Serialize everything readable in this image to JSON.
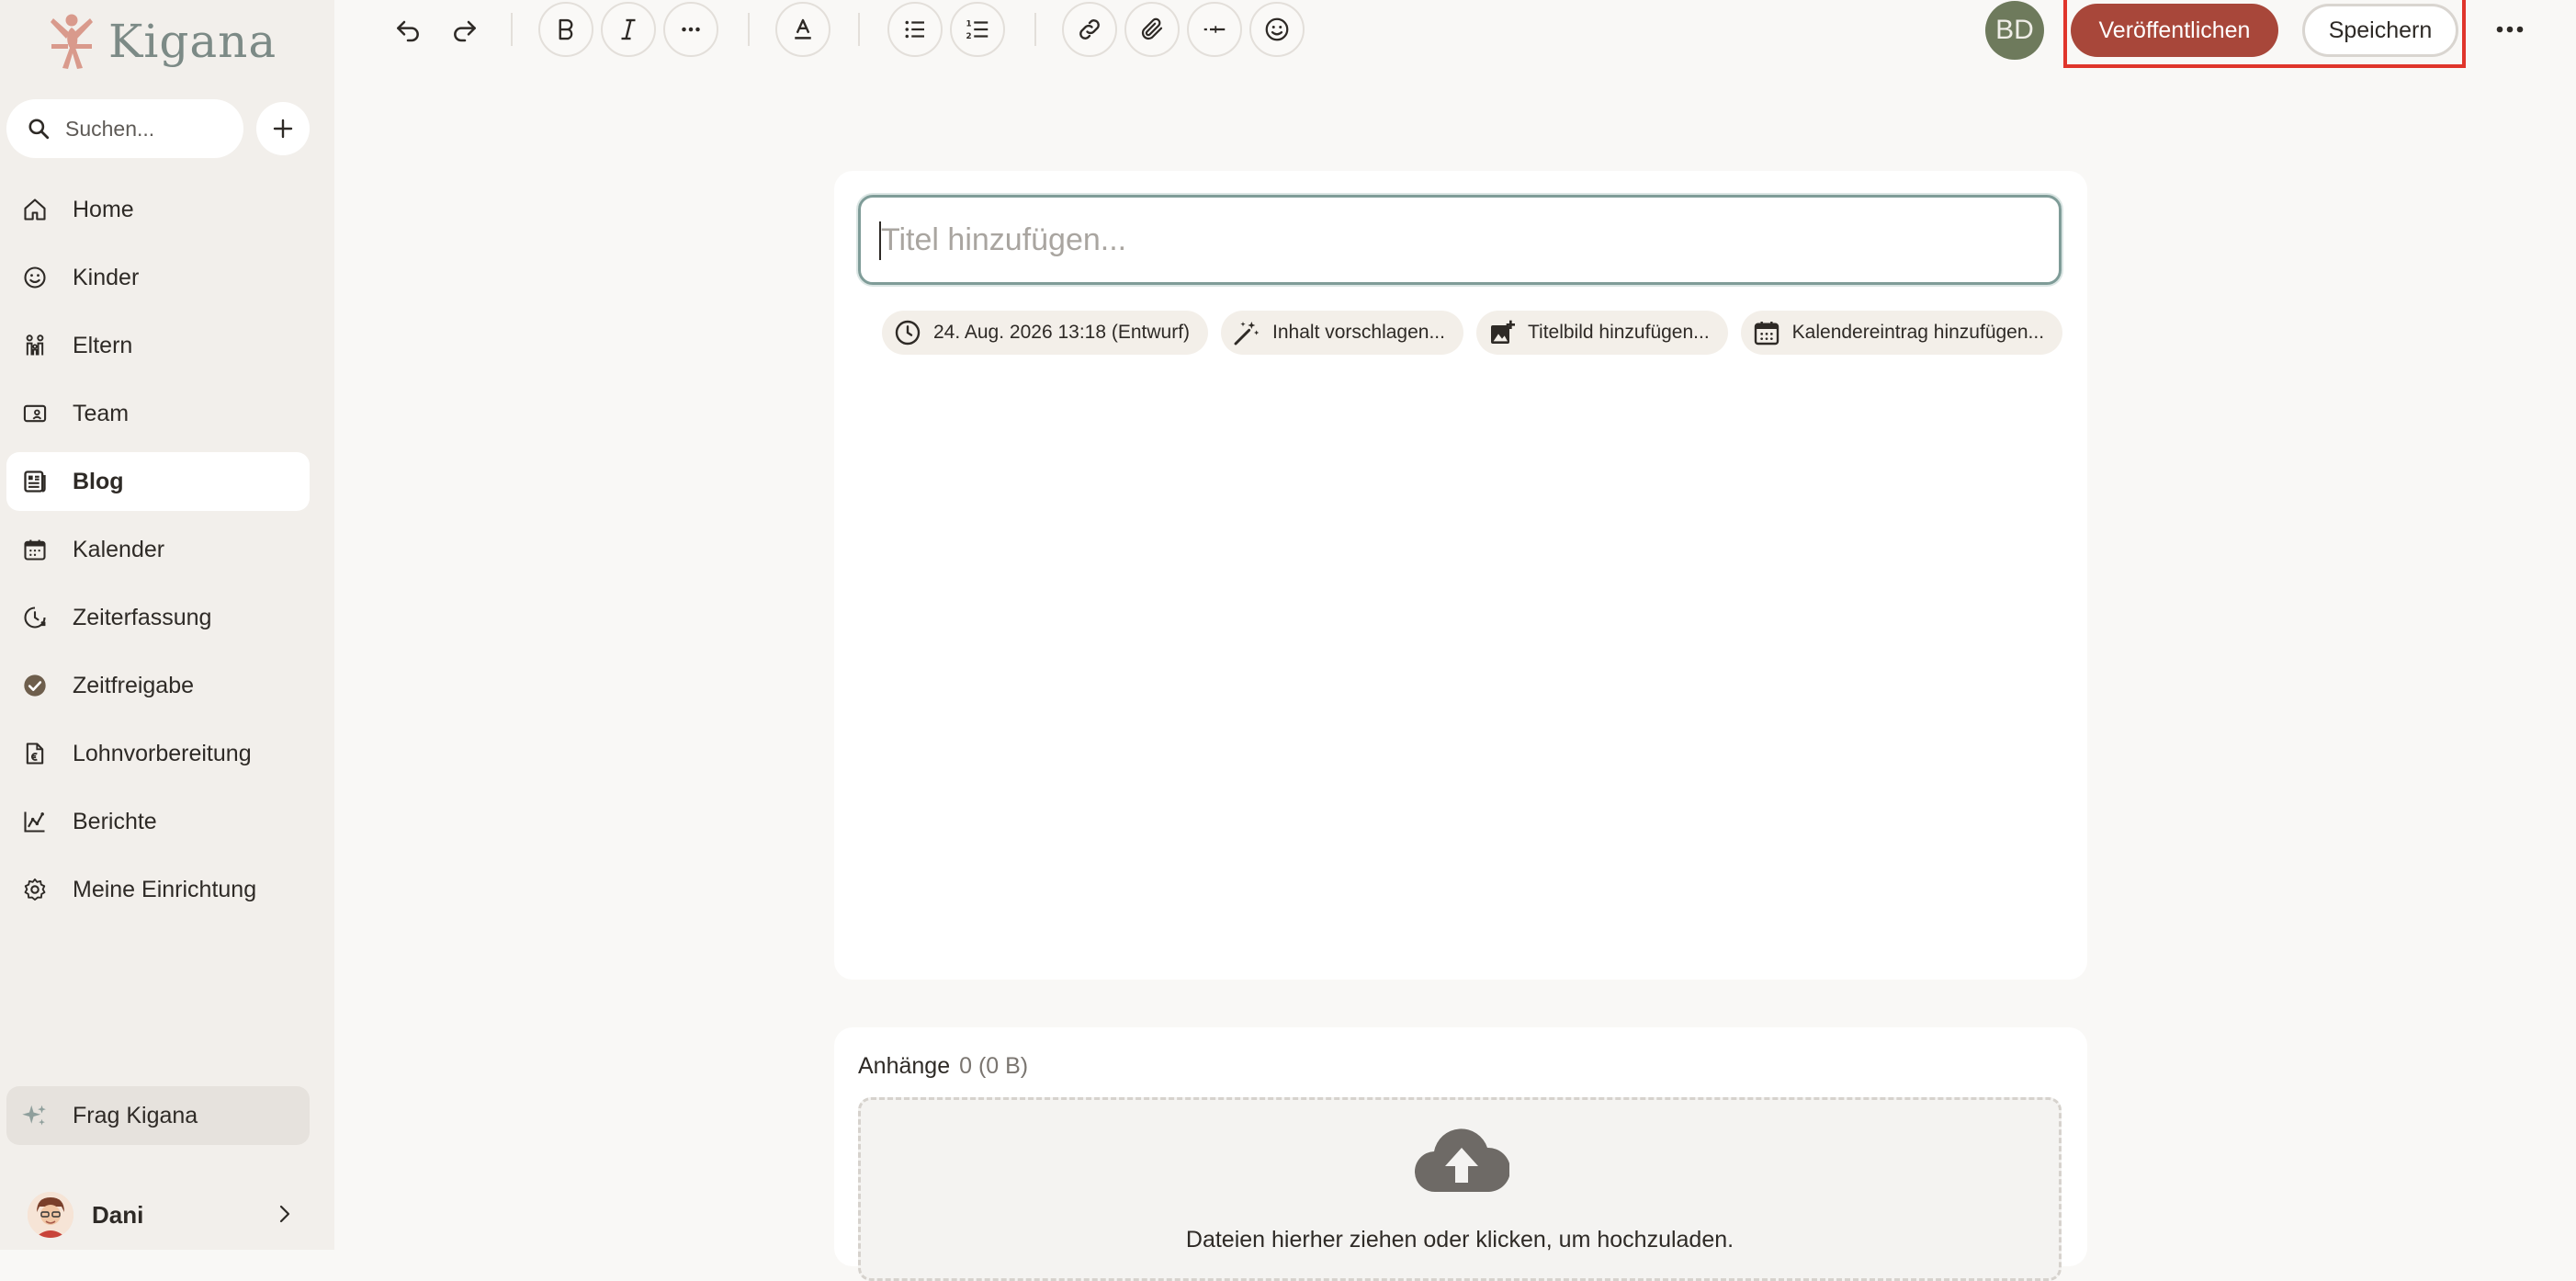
{
  "app": {
    "name": "Kigana"
  },
  "sidebar": {
    "search_placeholder": "Suchen...",
    "items": [
      {
        "label": "Home",
        "icon": "home-icon",
        "active": false
      },
      {
        "label": "Kinder",
        "icon": "smiley-icon",
        "active": false
      },
      {
        "label": "Eltern",
        "icon": "family-icon",
        "active": false
      },
      {
        "label": "Team",
        "icon": "id-card-icon",
        "active": false
      },
      {
        "label": "Blog",
        "icon": "blog-icon",
        "active": true
      },
      {
        "label": "Kalender",
        "icon": "calendar-icon",
        "active": false
      },
      {
        "label": "Zeiterfassung",
        "icon": "clock-icon",
        "active": false
      },
      {
        "label": "Zeitfreigabe",
        "icon": "check-circle-icon",
        "active": false
      },
      {
        "label": "Lohnvorbereitung",
        "icon": "payroll-doc-icon",
        "active": false
      },
      {
        "label": "Berichte",
        "icon": "chart-icon",
        "active": false
      },
      {
        "label": "Meine Einrichtung",
        "icon": "gear-icon",
        "active": false
      }
    ],
    "ask": "Frag Kigana",
    "user": "Dani"
  },
  "toolbar": {
    "avatar_initials": "BD",
    "publish_label": "Veröffentlichen",
    "save_label": "Speichern"
  },
  "editor": {
    "title_placeholder": "Titel hinzufügen...",
    "chips": {
      "date": "24. Aug. 2026 13:18 (Entwurf)",
      "suggest": "Inhalt vorschlagen...",
      "cover": "Titelbild hinzufügen...",
      "calendar": "Kalendereintrag hinzufügen..."
    }
  },
  "attachments": {
    "label": "Anhänge",
    "count": "0 (0 B)",
    "dropzone_text": "Dateien hierher ziehen oder klicken, um hochzuladen."
  },
  "colors": {
    "accent": "#a8473a",
    "sidebar_bg": "#f2efeb",
    "highlight": "#e0352b",
    "avatar": "#6e7a5c"
  }
}
